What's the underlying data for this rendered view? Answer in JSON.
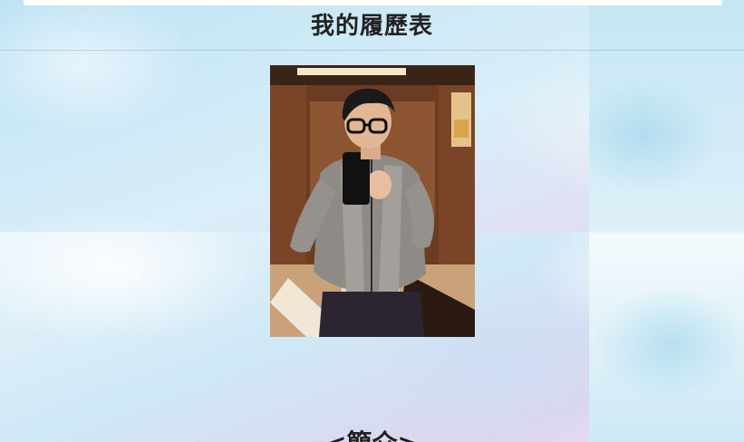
{
  "page": {
    "title": "我的履歷表",
    "section_heading": "<簡介>"
  },
  "profile_photo": {
    "description_icon": "portrait-photo",
    "alt": ""
  },
  "colors": {
    "background_blue": "#cfe7f6",
    "background_pink": "#f4e3f1",
    "title_text": "#222222"
  }
}
